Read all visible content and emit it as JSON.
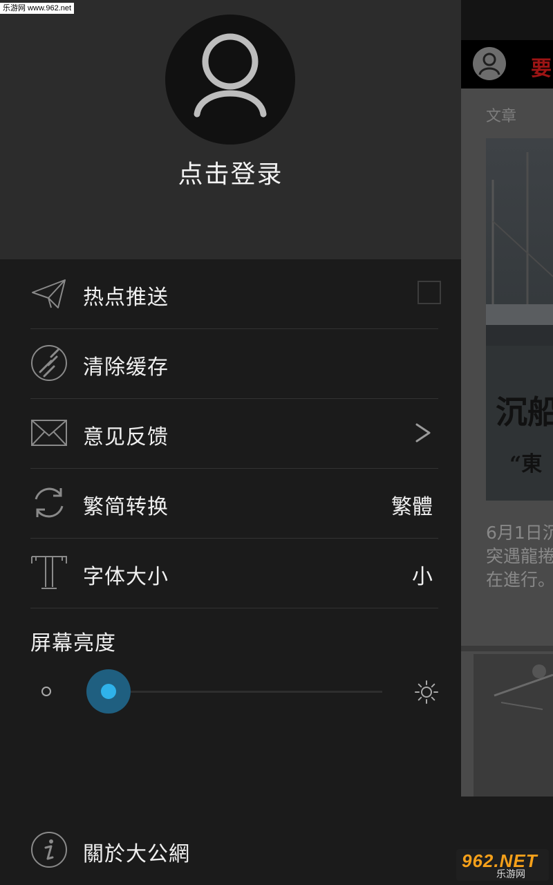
{
  "drawer": {
    "login_label": "点击登录",
    "menu": {
      "push": {
        "label": "热点推送",
        "checked": false
      },
      "cache": {
        "label": "清除缓存"
      },
      "feedback": {
        "label": "意见反馈"
      },
      "convert": {
        "label": "繁简转换",
        "value": "繁體"
      },
      "font": {
        "label": "字体大小",
        "value": "小"
      }
    },
    "brightness": {
      "title": "屏幕亮度",
      "level": 0.0
    },
    "about": {
      "label": "關於大公網"
    }
  },
  "background_app": {
    "tab_label": "要",
    "section_label": "文章",
    "image_overlay_text_1": "沉船",
    "image_overlay_text_2": "“東",
    "snippet": "6月1日沉 突遇龍捲 在進行。"
  },
  "watermarks": {
    "top_left": "乐游网 www.962.net",
    "bottom_right_logo": "962.NET",
    "bottom_right_sub": "乐游网"
  },
  "colors": {
    "drawer_bg": "#1b1b1b",
    "header_bg": "#2c2c2c",
    "accent": "#2fb2ea",
    "tab_red": "#9c1414"
  }
}
